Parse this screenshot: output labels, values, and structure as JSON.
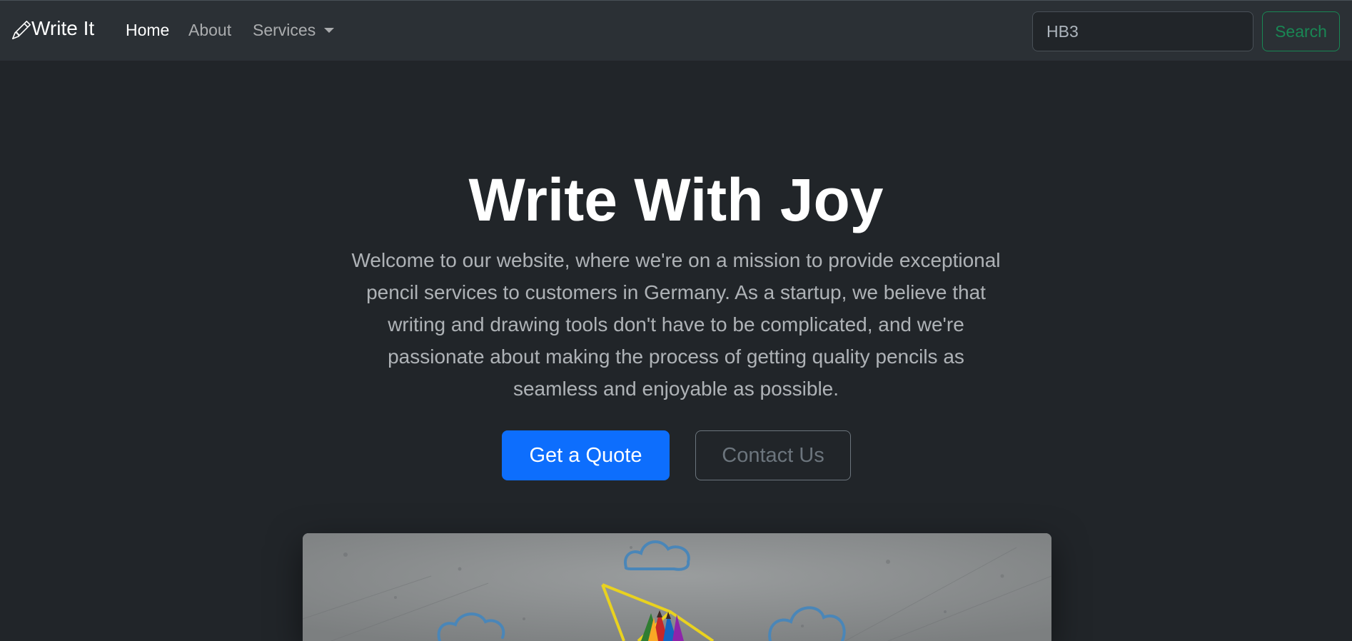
{
  "navbar": {
    "brand": "Write It",
    "links": [
      {
        "label": "Home",
        "active": true
      },
      {
        "label": "About",
        "active": false
      },
      {
        "label": "Services",
        "active": false,
        "dropdown": true
      }
    ],
    "search": {
      "value": "HB3",
      "placeholder": "Search"
    },
    "search_button": "Search"
  },
  "hero": {
    "title": "Write With Joy",
    "lead": "Welcome to our website, where we're on a mission to provide exceptional pencil services to customers in Germany. As a startup, we believe that writing and drawing tools don't have to be complicated, and we're passionate about making the process of getting quality pencils as seamless and enjoyable as possible.",
    "primary_button": "Get a Quote",
    "secondary_button": "Contact Us"
  },
  "colors": {
    "background": "#212529",
    "navbar": "#2b3035",
    "primary": "#0d6efd",
    "success": "#198754",
    "secondary": "#6c757d"
  },
  "icons": {
    "brand": "pencil-icon",
    "services_caret": "chevron-down-icon"
  }
}
